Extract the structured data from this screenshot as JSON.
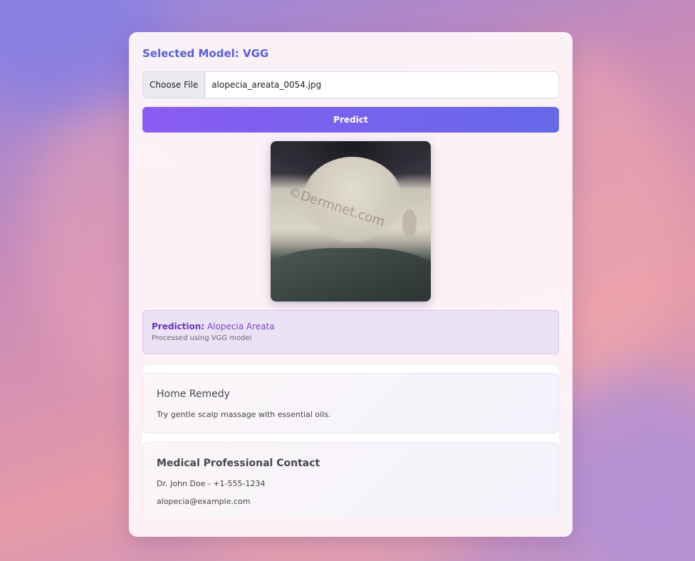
{
  "model": {
    "label": "Selected Model:",
    "name": "VGG"
  },
  "upload": {
    "button_label": "Choose File",
    "file_name": "alopecia_areata_0054.jpg"
  },
  "predict": {
    "button_label": "Predict"
  },
  "preview": {
    "watermark": "©Dermnet.com"
  },
  "prediction": {
    "label": "Prediction:",
    "value": "Alopecia Areata",
    "subtext": "Processed using VGG model"
  },
  "remedy": {
    "title": "Home Remedy",
    "text": "Try gentle scalp massage with essential oils."
  },
  "contact": {
    "title": "Medical Professional Contact",
    "doctor": "Dr. John Doe - +1-555-1234",
    "email": "alopecia@example.com"
  },
  "colors": {
    "accent": "#6568ea",
    "accent_start": "#8a5cf2",
    "prediction_text": "#7a45c6"
  }
}
